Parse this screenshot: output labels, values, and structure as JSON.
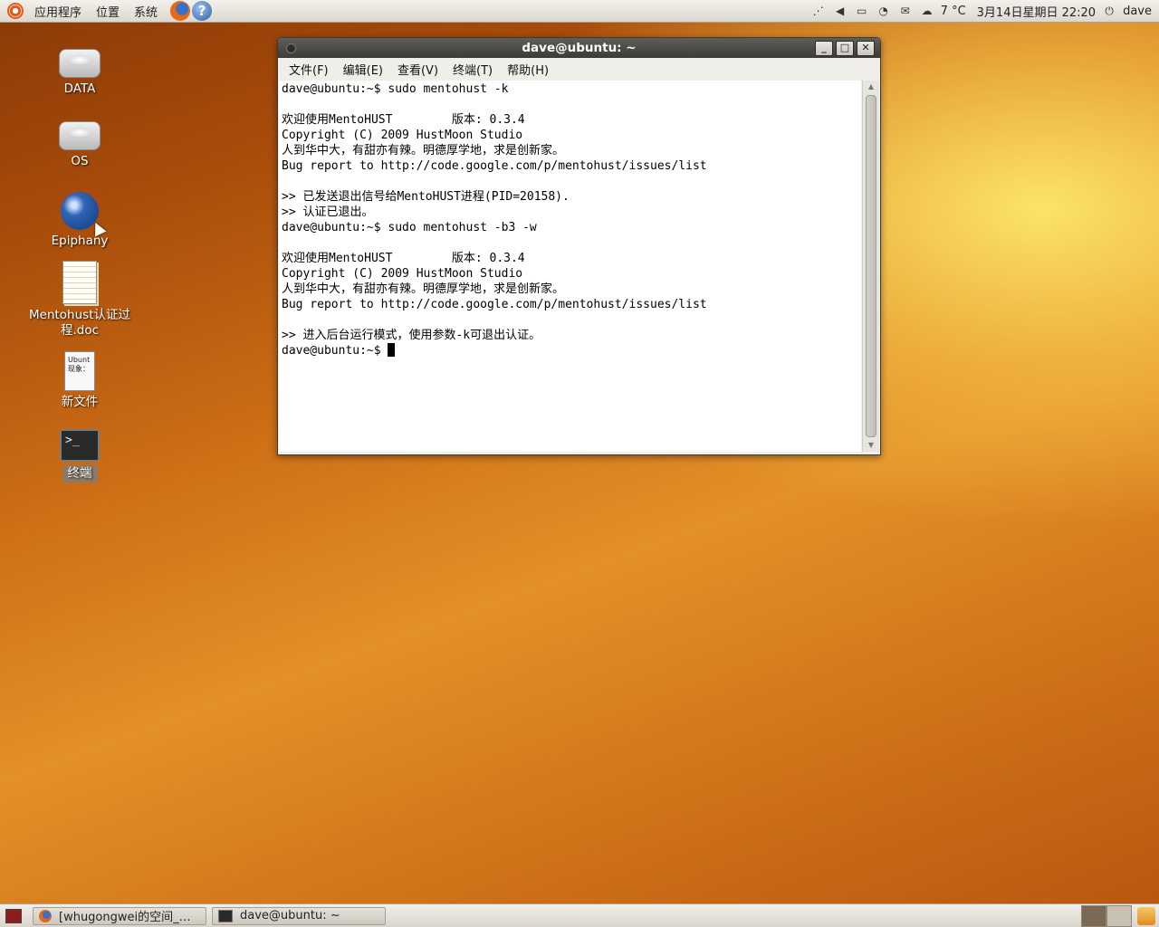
{
  "top_panel": {
    "menus": [
      "应用程序",
      "位置",
      "系统"
    ],
    "temperature": "7 °C",
    "datetime": "3月14日星期日 22:20",
    "user": "dave"
  },
  "desktop_icons": [
    {
      "label": "DATA"
    },
    {
      "label": "OS"
    },
    {
      "label": "Epiphany"
    },
    {
      "label": "Mentohust认证过程.doc"
    },
    {
      "label": "新文件",
      "preview": "Ubunt\n现象："
    },
    {
      "label": "终端"
    }
  ],
  "terminal": {
    "title": "dave@ubuntu: ~",
    "menus": [
      "文件(F)",
      "编辑(E)",
      "查看(V)",
      "终端(T)",
      "帮助(H)"
    ],
    "lines": [
      "dave@ubuntu:~$ sudo mentohust -k",
      "",
      "欢迎使用MentoHUST\t版本: 0.3.4",
      "Copyright (C) 2009 HustMoon Studio",
      "人到华中大，有甜亦有辣。明德厚学地，求是创新家。",
      "Bug report to http://code.google.com/p/mentohust/issues/list",
      "",
      ">> 已发送退出信号给MentoHUST进程(PID=20158).",
      ">> 认证已退出。",
      "dave@ubuntu:~$ sudo mentohust -b3 -w",
      "",
      "欢迎使用MentoHUST\t版本: 0.3.4",
      "Copyright (C) 2009 HustMoon Studio",
      "人到华中大，有甜亦有辣。明德厚学地，求是创新家。",
      "Bug report to http://code.google.com/p/mentohust/issues/list",
      "",
      ">> 进入后台运行模式，使用参数-k可退出认证。"
    ],
    "prompt": "dave@ubuntu:~$ "
  },
  "taskbar": {
    "tasks": [
      {
        "label": "[whugongwei的空间_…",
        "icon": "firefox-icon"
      },
      {
        "label": "dave@ubuntu: ~",
        "icon": "terminal-icon"
      }
    ]
  }
}
